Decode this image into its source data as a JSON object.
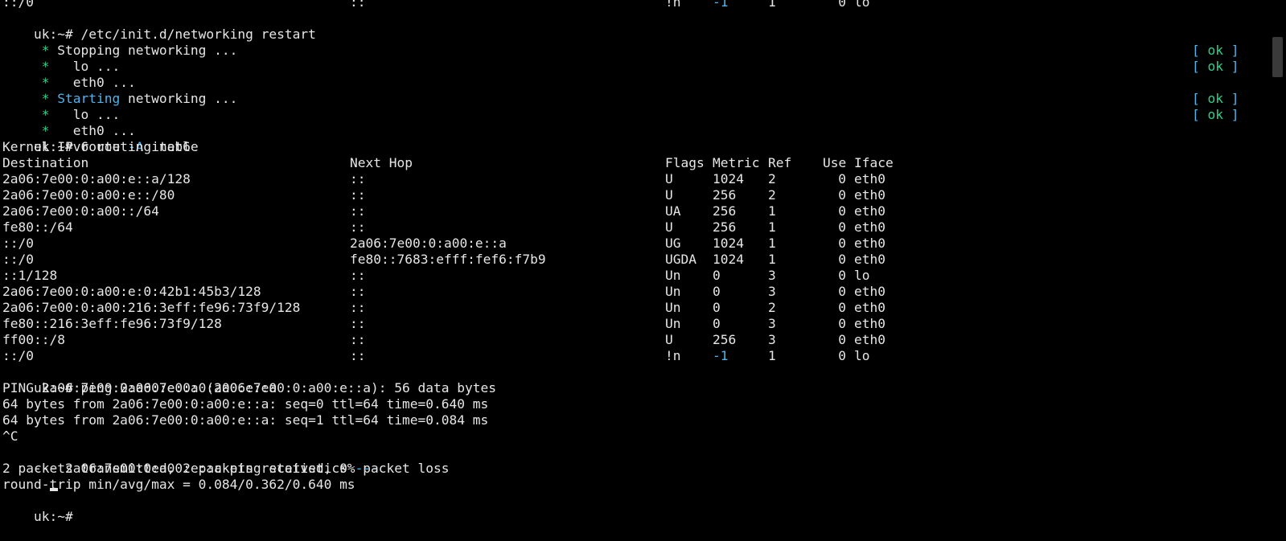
{
  "colors": {
    "background": "#000000",
    "foreground": "#e6e6e6",
    "ok_green": "#2fd18a",
    "accent_cyan": "#4fb3ec"
  },
  "terminal": {
    "top_partial": {
      "dest": "::/0",
      "hop": "::",
      "flags": "!n",
      "metric": "-1",
      "ref": "1",
      "use": "0",
      "iface": "lo"
    },
    "cmd1": {
      "prompt": "uk:~#",
      "text": " /etc/init.d/networking restart"
    },
    "stopping": {
      "star": " *",
      "word": " Stopping",
      "rest": " networking ..."
    },
    "stop_lo": {
      "star": " *",
      "text": "   lo ...",
      "ok": "ok"
    },
    "stop_eth0": {
      "star": " *",
      "text": "   eth0 ...",
      "ok": "ok"
    },
    "starting": {
      "star": " *",
      "word": " Starting",
      "rest": " networking ..."
    },
    "start_lo": {
      "star": " *",
      "text": "   lo ...",
      "ok": "ok"
    },
    "start_eth0": {
      "star": " *",
      "text": "   eth0 ...",
      "ok": "ok"
    },
    "bracket_open": "[",
    "bracket_close": "]",
    "cmd2": {
      "prompt": "uk:~#",
      "pre": " route ",
      "flag": "-A",
      "post": " inet6"
    },
    "route_title": "Kernel IPv6 routing table",
    "route_headers": {
      "destination": "Destination",
      "next_hop": "Next Hop",
      "flags": "Flags",
      "metric": "Metric",
      "ref": "Ref",
      "use": "Use",
      "iface": "Iface"
    },
    "routes": [
      {
        "dest": "2a06:7e00:0:a00:e::a/128",
        "hop": "::",
        "flags": "U",
        "metric": "1024",
        "ref": "2",
        "use": "0",
        "iface": "eth0"
      },
      {
        "dest": "2a06:7e00:0:a00:e::/80",
        "hop": "::",
        "flags": "U",
        "metric": "256",
        "ref": "2",
        "use": "0",
        "iface": "eth0"
      },
      {
        "dest": "2a06:7e00:0:a00::/64",
        "hop": "::",
        "flags": "UA",
        "metric": "256",
        "ref": "1",
        "use": "0",
        "iface": "eth0"
      },
      {
        "dest": "fe80::/64",
        "hop": "::",
        "flags": "U",
        "metric": "256",
        "ref": "1",
        "use": "0",
        "iface": "eth0"
      },
      {
        "dest": "::/0",
        "hop": "2a06:7e00:0:a00:e::a",
        "flags": "UG",
        "metric": "1024",
        "ref": "1",
        "use": "0",
        "iface": "eth0"
      },
      {
        "dest": "::/0",
        "hop": "fe80::7683:efff:fef6:f7b9",
        "flags": "UGDA",
        "metric": "1024",
        "ref": "1",
        "use": "0",
        "iface": "eth0"
      },
      {
        "dest": "::1/128",
        "hop": "::",
        "flags": "Un",
        "metric": "0",
        "ref": "3",
        "use": "0",
        "iface": "lo"
      },
      {
        "dest": "2a06:7e00:0:a00:e:0:42b1:45b3/128",
        "hop": "::",
        "flags": "Un",
        "metric": "0",
        "ref": "3",
        "use": "0",
        "iface": "eth0"
      },
      {
        "dest": "2a06:7e00:0:a00:216:3eff:fe96:73f9/128",
        "hop": "::",
        "flags": "Un",
        "metric": "0",
        "ref": "2",
        "use": "0",
        "iface": "eth0"
      },
      {
        "dest": "fe80::216:3eff:fe96:73f9/128",
        "hop": "::",
        "flags": "Un",
        "metric": "0",
        "ref": "3",
        "use": "0",
        "iface": "eth0"
      },
      {
        "dest": "ff00::/8",
        "hop": "::",
        "flags": "U",
        "metric": "256",
        "ref": "3",
        "use": "0",
        "iface": "eth0"
      },
      {
        "dest": "::/0",
        "hop": "::",
        "flags": "!n",
        "metric": "-1",
        "ref": "1",
        "use": "0",
        "iface": "lo"
      }
    ],
    "cmd3": {
      "prompt": "uk:~#",
      "text": " ping 2a06:7e00:0:a00:e::a"
    },
    "ping_header": "PING 2a06:7e00:0:a00:e::a (2a06:7e00:0:a00:e::a): 56 data bytes",
    "ping_reply_1": "64 bytes from 2a06:7e00:0:a00:e::a: seq=0 ttl=64 time=0.640 ms",
    "ping_reply_2": "64 bytes from 2a06:7e00:0:a00:e::a: seq=1 ttl=64 time=0.084 ms",
    "interrupt": "^C",
    "stats_header": {
      "pre": "--- 2a06:7e00:0:a00:e::a ping statistics ",
      "post": "---"
    },
    "stats_packets": "2 packets transmitted, 2 packets received, 0% packet loss",
    "stats_rtt": "round-trip min/avg/max = 0.084/0.362/0.640 ms",
    "prompt_final": "uk:~#"
  }
}
